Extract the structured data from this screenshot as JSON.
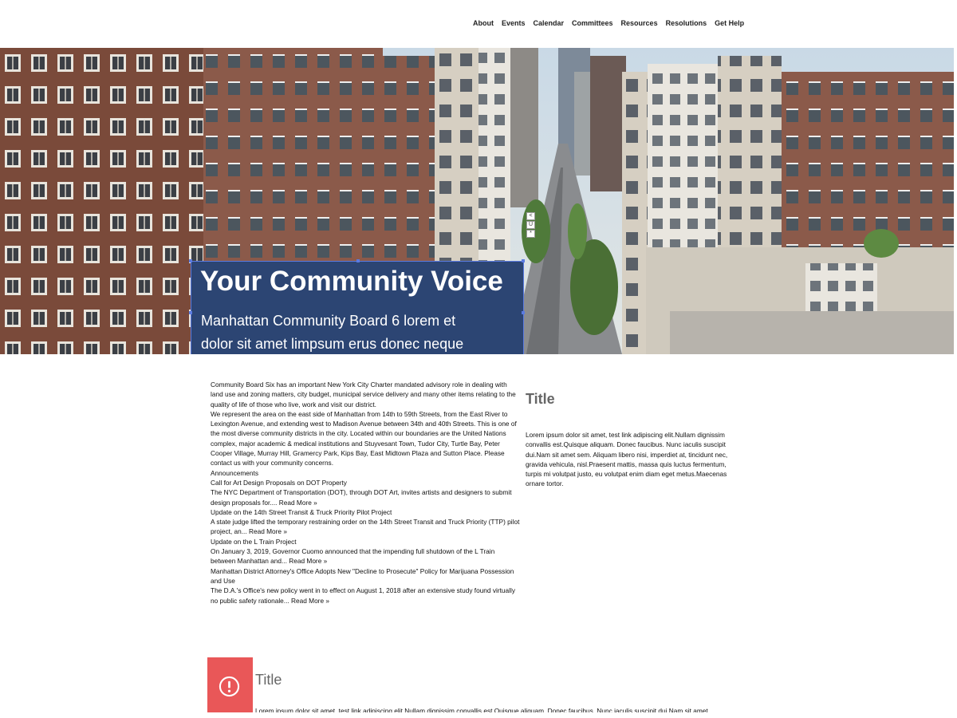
{
  "nav": {
    "items": [
      "About",
      "Events",
      "Calendar",
      "Committees",
      "Resources",
      "Resolutions",
      "Get Help"
    ]
  },
  "hero": {
    "title": "Your Community Voice",
    "subtitle": "Manhattan Community Board 6 lorem et dolor sit amet limpsum erus donec neque",
    "background": "city-street-photo",
    "box_color": "#2c4573"
  },
  "intro": {
    "p1": "Community Board Six has an important New York City Charter mandated advisory role in dealing with land use and zoning matters, city budget, municipal service delivery and many other items relating to the quality of life of those who live, work and visit our district.",
    "p2": "We represent the area on the east side of Manhattan from 14th to 59th Streets, from the East River to Lexington Avenue, and extending west to Madison Avenue between 34th and 40th Streets. This is one of the most diverse community districts in the city.  Located within our boundaries are the United Nations complex, major academic & medical institutions and Stuyvesant Town, Tudor City, Turtle Bay, Peter Cooper Village, Murray Hill, Gramercy Park, Kips Bay, East Midtown Plaza and Sutton Place. Please contact us  with your community concerns."
  },
  "announcements": {
    "heading": "Announcements",
    "read_more": "Read More »",
    "items": [
      {
        "title": "Call for Art Design Proposals on DOT Property",
        "summary": "The NYC Department of Transportation (DOT), through DOT Art, invites artists and designers to submit design proposals for.... "
      },
      {
        "title": "Update on the 14th Street Transit & Truck Priority Pilot Project",
        "summary": "A state judge lifted the temporary restraining order on the 14th Street Transit and Truck Priority (TTP) pilot project, an... "
      },
      {
        "title": "Update on the L Train Project",
        "summary": "On January 3, 2019, Governor Cuomo announced that the impending full shutdown of the L Train between Manhattan and... "
      },
      {
        "title": "Manhattan District Attorney's Office Adopts New \"Decline to Prosecute\" Policy for Marijuana Possession and Use",
        "summary": "The D.A.'s Office's new policy went in to effect on August 1, 2018 after an extensive study found virtually no public safety rationale... "
      }
    ]
  },
  "sidebar": {
    "title": "Title",
    "body": "Lorem ipsum dolor sit amet, test link adipiscing elit.Nullam dignissim convallis est.Quisque aliquam. Donec faucibus. Nunc iaculis suscipit dui.Nam sit amet sem. Aliquam libero nisi, imperdiet at, tincidunt nec, gravida vehicula, nisl.Praesent mattis, massa quis luctus fermentum, turpis mi volutpat justo, eu volutpat enim diam eget metus.Maecenas ornare tortor."
  },
  "alert": {
    "title": "Title",
    "icon": "exclamation-circle-icon",
    "color": "#e95758",
    "body": "Lorem ipsum dolor sit amet, test link adipiscing elit.Nullam dignissim convallis est.Quisque aliquam. Donec faucibus. Nunc iaculis suscipit dui.Nam sit amet"
  },
  "edit_tools": [
    "<",
    "U",
    "*"
  ]
}
